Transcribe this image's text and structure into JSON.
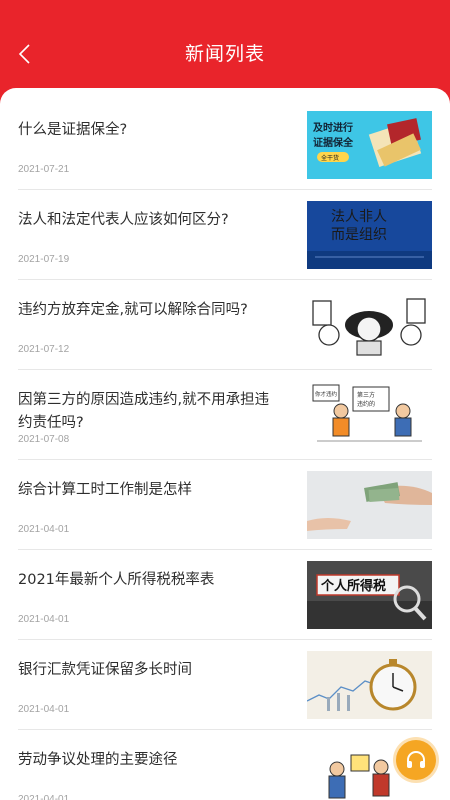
{
  "header": {
    "title": "新闻列表",
    "back_icon": "chevron-left-icon"
  },
  "news": [
    {
      "title": "什么是证据保全?",
      "date": "2021-07-21",
      "image": "evidence-preservation-image"
    },
    {
      "title": "法人和法定代表人应该如何区分?",
      "date": "2021-07-19",
      "image": "legal-person-image"
    },
    {
      "title": "违约方放弃定金,就可以解除合同吗?",
      "date": "2021-07-12",
      "image": "contract-cartoon-image"
    },
    {
      "title": "因第三方的原因造成违约,就不用承担违约责任吗?",
      "date": "2021-07-08",
      "image": "breach-cartoon-image"
    },
    {
      "title": "综合计算工时工作制是怎样",
      "date": "2021-04-01",
      "image": "money-handover-image"
    },
    {
      "title": "2021年最新个人所得税税率表",
      "date": "2021-04-01",
      "image": "income-tax-image"
    },
    {
      "title": "银行汇款凭证保留多长时间",
      "date": "2021-04-01",
      "image": "clock-finance-image"
    },
    {
      "title": "劳动争议处理的主要途径",
      "date": "2021-04-01",
      "image": "labor-dispute-image"
    }
  ],
  "thumb_text": {
    "evidence": [
      "及时进行",
      "证据保全",
      "全干货"
    ],
    "legal": [
      "法人非人",
      "而是组织"
    ],
    "breach": [
      "第三方",
      "违约的",
      "你才违约"
    ],
    "tax": "个人所得税"
  },
  "floating_button": {
    "icon": "headset-icon"
  },
  "colors": {
    "brand": "#e9242b",
    "float": "#f5a623"
  }
}
